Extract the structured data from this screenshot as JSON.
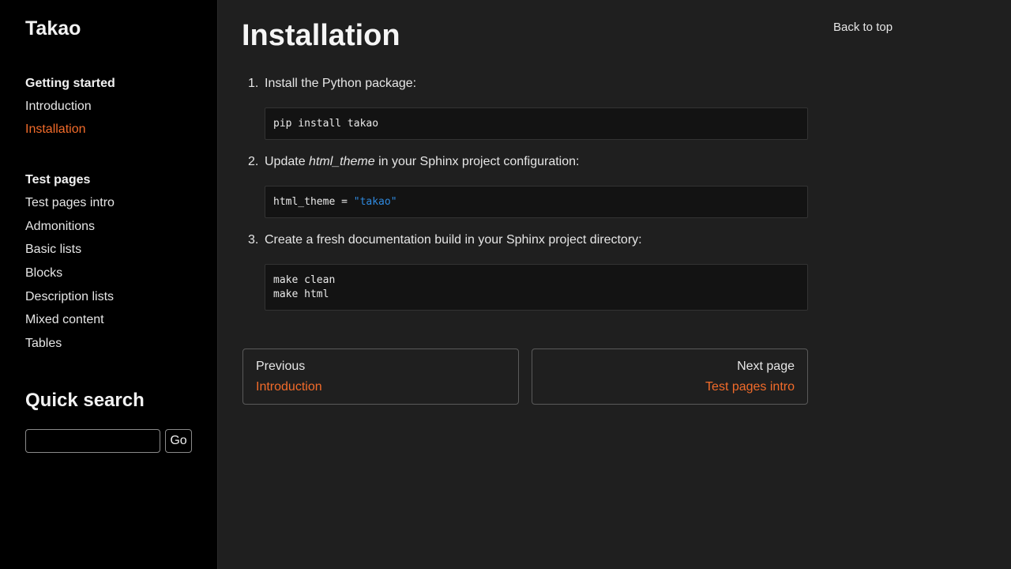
{
  "sidebar": {
    "site_title": "Takao",
    "sections": [
      {
        "title": "Getting started",
        "items": [
          {
            "label": "Introduction"
          },
          {
            "label": "Installation"
          }
        ]
      },
      {
        "title": "Test pages",
        "items": [
          {
            "label": "Test pages intro"
          },
          {
            "label": "Admonitions"
          },
          {
            "label": "Basic lists"
          },
          {
            "label": "Blocks"
          },
          {
            "label": "Description lists"
          },
          {
            "label": "Mixed content"
          },
          {
            "label": "Tables"
          }
        ]
      }
    ],
    "search": {
      "title": "Quick search",
      "input_value": "",
      "button_label": "Go"
    }
  },
  "main": {
    "page_title": "Installation",
    "back_to_top": "Back to top",
    "steps": [
      {
        "number": "1.",
        "text": "Install the Python package:",
        "code": "pip install takao"
      },
      {
        "number": "2.",
        "text_before": "Update ",
        "text_em": "html_theme",
        "text_after": " in your Sphinx project configuration:",
        "code_plain": "html_theme = ",
        "code_string": "\"takao\""
      },
      {
        "number": "3.",
        "text": "Create a fresh documentation build in your Sphinx project directory:",
        "code_lines": [
          "make clean",
          "make html"
        ]
      }
    ],
    "pager": {
      "prev_label": "Previous",
      "prev_title": "Introduction",
      "next_label": "Next page",
      "next_title": "Test pages intro"
    }
  },
  "colors": {
    "accent": "#f26b2a",
    "sidebar_bg": "#000000",
    "main_bg": "#1f1f1f",
    "code_bg": "#131313",
    "code_string": "#2f8ae0"
  }
}
